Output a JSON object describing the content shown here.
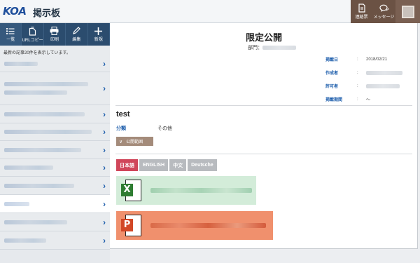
{
  "header": {
    "logo": "KOA",
    "app_title": "掲示板",
    "contact_label": "連絡票",
    "message_label": "メッセージ"
  },
  "toolbar": {
    "list_label": "一覧",
    "url_copy_label": "URLコピー",
    "print_label": "印刷",
    "edit_label": "編集",
    "new_label": "新規"
  },
  "sidebar": {
    "notice": "最新の記事20件を表示しています。",
    "items_count_visible": 11
  },
  "post": {
    "title": "限定公開",
    "dept_label": "部門：",
    "meta": {
      "posted_date_label": "掲載日",
      "posted_date_value": "2018/02/21",
      "author_label": "作成者",
      "approver_label": "許可者",
      "period_label": "掲載期間",
      "period_value": "～",
      "colon": ":"
    },
    "body_title": "test",
    "category_label": "分類",
    "category_value": "その他",
    "scope_button": "公開範囲",
    "languages": [
      "日本語",
      "ENGLISH",
      "中文",
      "Deutsche"
    ],
    "attachments": [
      {
        "type": "excel",
        "icon_letter": "X"
      },
      {
        "type": "powerpoint",
        "icon_letter": "P"
      }
    ]
  },
  "colors": {
    "navy": "#2b4c6e",
    "accent_blue": "#1b5cab",
    "brown": "#6b5244",
    "active_lang": "#d0465a"
  }
}
